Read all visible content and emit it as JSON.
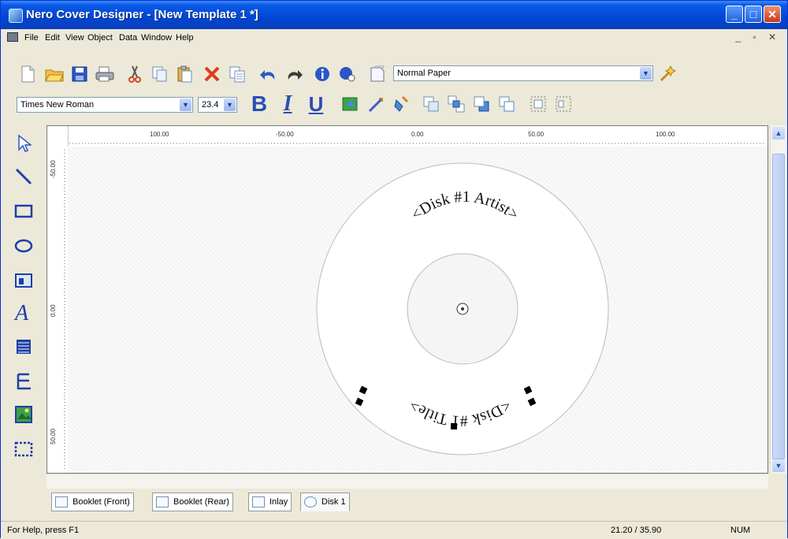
{
  "window": {
    "title": "Nero Cover Designer - [New Template 1 *]"
  },
  "menu": [
    "File",
    "Edit",
    "View",
    "Object",
    "Data",
    "Window",
    "Help"
  ],
  "toolbar1": {
    "paper_select": "Normal Paper",
    "icons": [
      "new-icon",
      "open-icon",
      "save-icon",
      "print-icon",
      "cut-icon",
      "copy-icon",
      "paste-icon",
      "delete-icon",
      "duplicate-icon",
      "undo-icon",
      "redo-icon",
      "info-icon",
      "web-update-icon",
      "paper-icon"
    ]
  },
  "toolbar2": {
    "font": "Times New Roman",
    "size": "23.4",
    "bold_label": "B",
    "italic_label": "I",
    "underline_label": "U",
    "icons": [
      "fill-color-icon",
      "line-color-icon",
      "shading-icon",
      "bring-front-icon",
      "group-icon",
      "send-back-icon",
      "ungroup-icon",
      "align-icon",
      "distribute-icon"
    ]
  },
  "left_tools": [
    "select-tool-icon",
    "line-tool-icon",
    "rectangle-tool-icon",
    "ellipse-tool-icon",
    "image-frame-tool-icon",
    "text-tool-icon",
    "list-tool-icon",
    "tree-tool-icon",
    "picture-tool-icon",
    "selection-rect-tool-icon"
  ],
  "ruler": {
    "h_labels": [
      "100.00",
      "-50.00",
      "0.00",
      "50.00",
      "100.00"
    ],
    "v_labels": [
      "-50.00",
      "0.00",
      "50.00"
    ]
  },
  "disc": {
    "top_text": "<Disk #1 Artist>",
    "bottom_text": "<Disk #1 Title>"
  },
  "tabs": [
    {
      "label": "Booklet (Front)"
    },
    {
      "label": "Booklet (Rear)"
    },
    {
      "label": "Inlay"
    },
    {
      "label": "Disk 1"
    }
  ],
  "status": {
    "help": "For Help, press F1",
    "coords": "21.20 / 35.90",
    "num": "NUM"
  },
  "colors": {
    "titlebar": "#0046d5",
    "workspace": "#ece9d8"
  }
}
